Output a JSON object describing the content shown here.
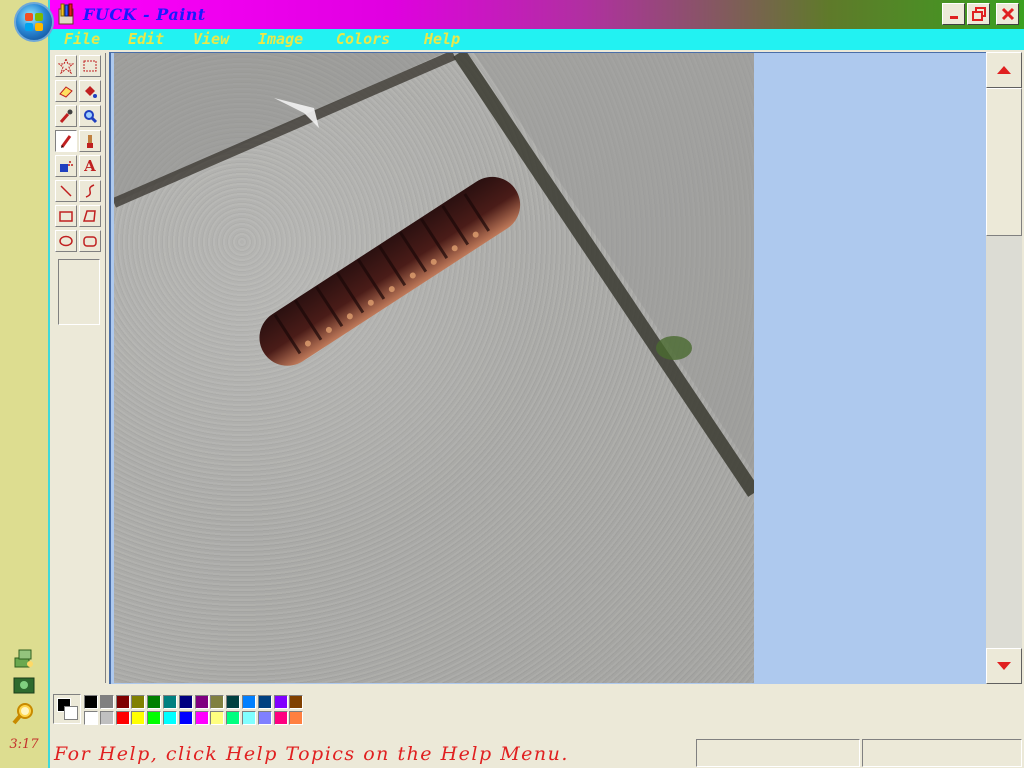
{
  "window": {
    "title": "FUCK - Paint"
  },
  "menu": {
    "items": [
      "File",
      "Edit",
      "View",
      "Image",
      "Colors",
      "Help"
    ]
  },
  "toolbox": {
    "tools": [
      {
        "name": "free-form-select",
        "icon": "star-select-icon"
      },
      {
        "name": "select",
        "icon": "rect-select-icon"
      },
      {
        "name": "eraser",
        "icon": "eraser-icon"
      },
      {
        "name": "fill",
        "icon": "paint-bucket-icon"
      },
      {
        "name": "pick-color",
        "icon": "eyedropper-icon"
      },
      {
        "name": "magnifier",
        "icon": "magnifier-icon"
      },
      {
        "name": "pencil",
        "icon": "pencil-icon",
        "active": true
      },
      {
        "name": "brush",
        "icon": "brush-icon"
      },
      {
        "name": "airbrush",
        "icon": "airbrush-icon"
      },
      {
        "name": "text",
        "icon": "text-icon",
        "label": "A"
      },
      {
        "name": "line",
        "icon": "line-icon"
      },
      {
        "name": "curve",
        "icon": "curve-icon"
      },
      {
        "name": "rectangle",
        "icon": "rectangle-icon"
      },
      {
        "name": "polygon",
        "icon": "polygon-icon"
      },
      {
        "name": "ellipse",
        "icon": "ellipse-icon"
      },
      {
        "name": "rounded-rectangle",
        "icon": "rounded-rect-icon"
      }
    ]
  },
  "palette": {
    "foreground": "#000000",
    "background": "#ffffff",
    "top_row": [
      "#000000",
      "#808080",
      "#800000",
      "#808000",
      "#008000",
      "#008080",
      "#000080",
      "#800080",
      "#808040",
      "#004040",
      "#0080ff",
      "#004080",
      "#8000ff",
      "#804000"
    ],
    "bottom_row": [
      "#ffffff",
      "#c0c0c0",
      "#ff0000",
      "#ffff00",
      "#00ff00",
      "#00ffff",
      "#0000ff",
      "#ff00ff",
      "#ffff80",
      "#00ff80",
      "#80ffff",
      "#8080ff",
      "#ff0080",
      "#ff8040"
    ]
  },
  "status": {
    "text": "For Help, click Help Topics on the Help Menu."
  },
  "taskbar": {
    "clock": "3:17"
  },
  "colors": {
    "titlebar_text": "#1a1aff",
    "menu_bg": "#22f2f2",
    "menu_text": "#e8e84a",
    "status_text": "#e02020",
    "workspace_bg": "#aec9ee"
  }
}
